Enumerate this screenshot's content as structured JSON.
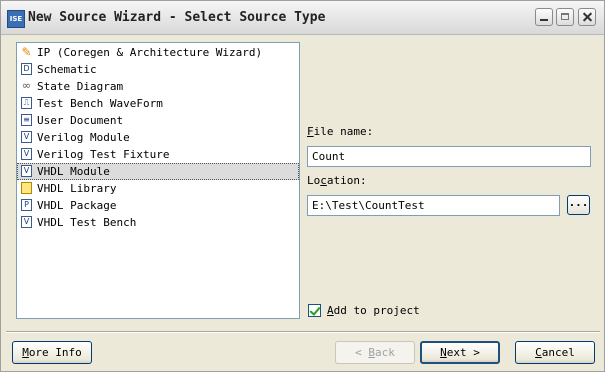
{
  "window": {
    "title": "New Source Wizard - Select Source Type",
    "app_icon_text": "ISE"
  },
  "source_types": [
    {
      "label": "IP (Coregen & Architecture Wizard)",
      "icon": "ip-bulb-icon",
      "glyph": "✎"
    },
    {
      "label": "Schematic",
      "icon": "schematic-icon",
      "glyph": "D"
    },
    {
      "label": "State Diagram",
      "icon": "state-diagram-icon",
      "glyph": "∞"
    },
    {
      "label": "Test Bench WaveForm",
      "icon": "waveform-icon",
      "glyph": "⎍"
    },
    {
      "label": "User Document",
      "icon": "document-icon",
      "glyph": "≡"
    },
    {
      "label": "Verilog Module",
      "icon": "verilog-module-icon",
      "glyph": "V"
    },
    {
      "label": "Verilog Test Fixture",
      "icon": "verilog-test-fixture-icon",
      "glyph": "V"
    },
    {
      "label": "VHDL Module",
      "icon": "vhdl-module-icon",
      "glyph": "V"
    },
    {
      "label": "VHDL Library",
      "icon": "vhdl-library-icon",
      "glyph": ""
    },
    {
      "label": "VHDL Package",
      "icon": "vhdl-package-icon",
      "glyph": "P"
    },
    {
      "label": "VHDL Test Bench",
      "icon": "vhdl-test-bench-icon",
      "glyph": "V"
    }
  ],
  "selected_index": 7,
  "form": {
    "file_name_label": "File name:",
    "file_name_value": "Count",
    "location_label": "Location:",
    "location_value": "E:\\Test\\CountTest",
    "browse_label": "...",
    "add_to_project_label": "Add to project",
    "add_to_project_checked": true
  },
  "buttons": {
    "more_info": "More Info",
    "back": "< Back",
    "next": "Next >",
    "cancel": "Cancel"
  },
  "colors": {
    "dialog_bg": "#ece9d8",
    "selection_bg": "#dcdcdc",
    "border": "#7f9db9",
    "check": "#21a121"
  }
}
